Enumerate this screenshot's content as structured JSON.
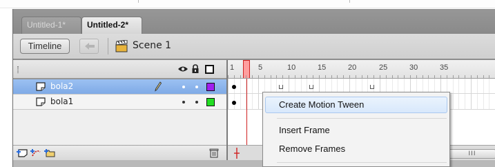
{
  "tabs": [
    {
      "label": "Untitled-1*",
      "active": false
    },
    {
      "label": "Untitled-2*",
      "active": true
    }
  ],
  "editbar": {
    "timeline_label": "Timeline",
    "back_icon": "left-arrow-icon",
    "scene_icon": "clapperboard-icon",
    "scene_label": "Scene 1"
  },
  "layer_header": {
    "icons": [
      "eye-icon",
      "lock-icon",
      "outline-icon"
    ]
  },
  "ruler": {
    "labels": [
      "1",
      "5",
      "10",
      "15",
      "20",
      "25",
      "30",
      "35"
    ],
    "current_frame": "1"
  },
  "layers": [
    {
      "name": "bola2",
      "selected": true,
      "outline_color": "#a020f0"
    },
    {
      "name": "bola1",
      "selected": false,
      "outline_color": "#22dd22"
    }
  ],
  "bottom_toolbar": {
    "icons": [
      "new-layer-icon",
      "add-motion-guide-icon",
      "new-folder-icon",
      "trash-icon"
    ],
    "scroll_label": "III"
  },
  "context_menu": {
    "items": [
      {
        "label": "Create Motion Tween",
        "highlighted": true
      },
      {
        "label": "Insert Frame",
        "highlighted": false
      },
      {
        "label": "Remove Frames",
        "highlighted": false
      }
    ]
  },
  "colors": {
    "selection": "#7faae6",
    "playhead": "#d02020",
    "menu_highlight": "#d8e8fb"
  }
}
